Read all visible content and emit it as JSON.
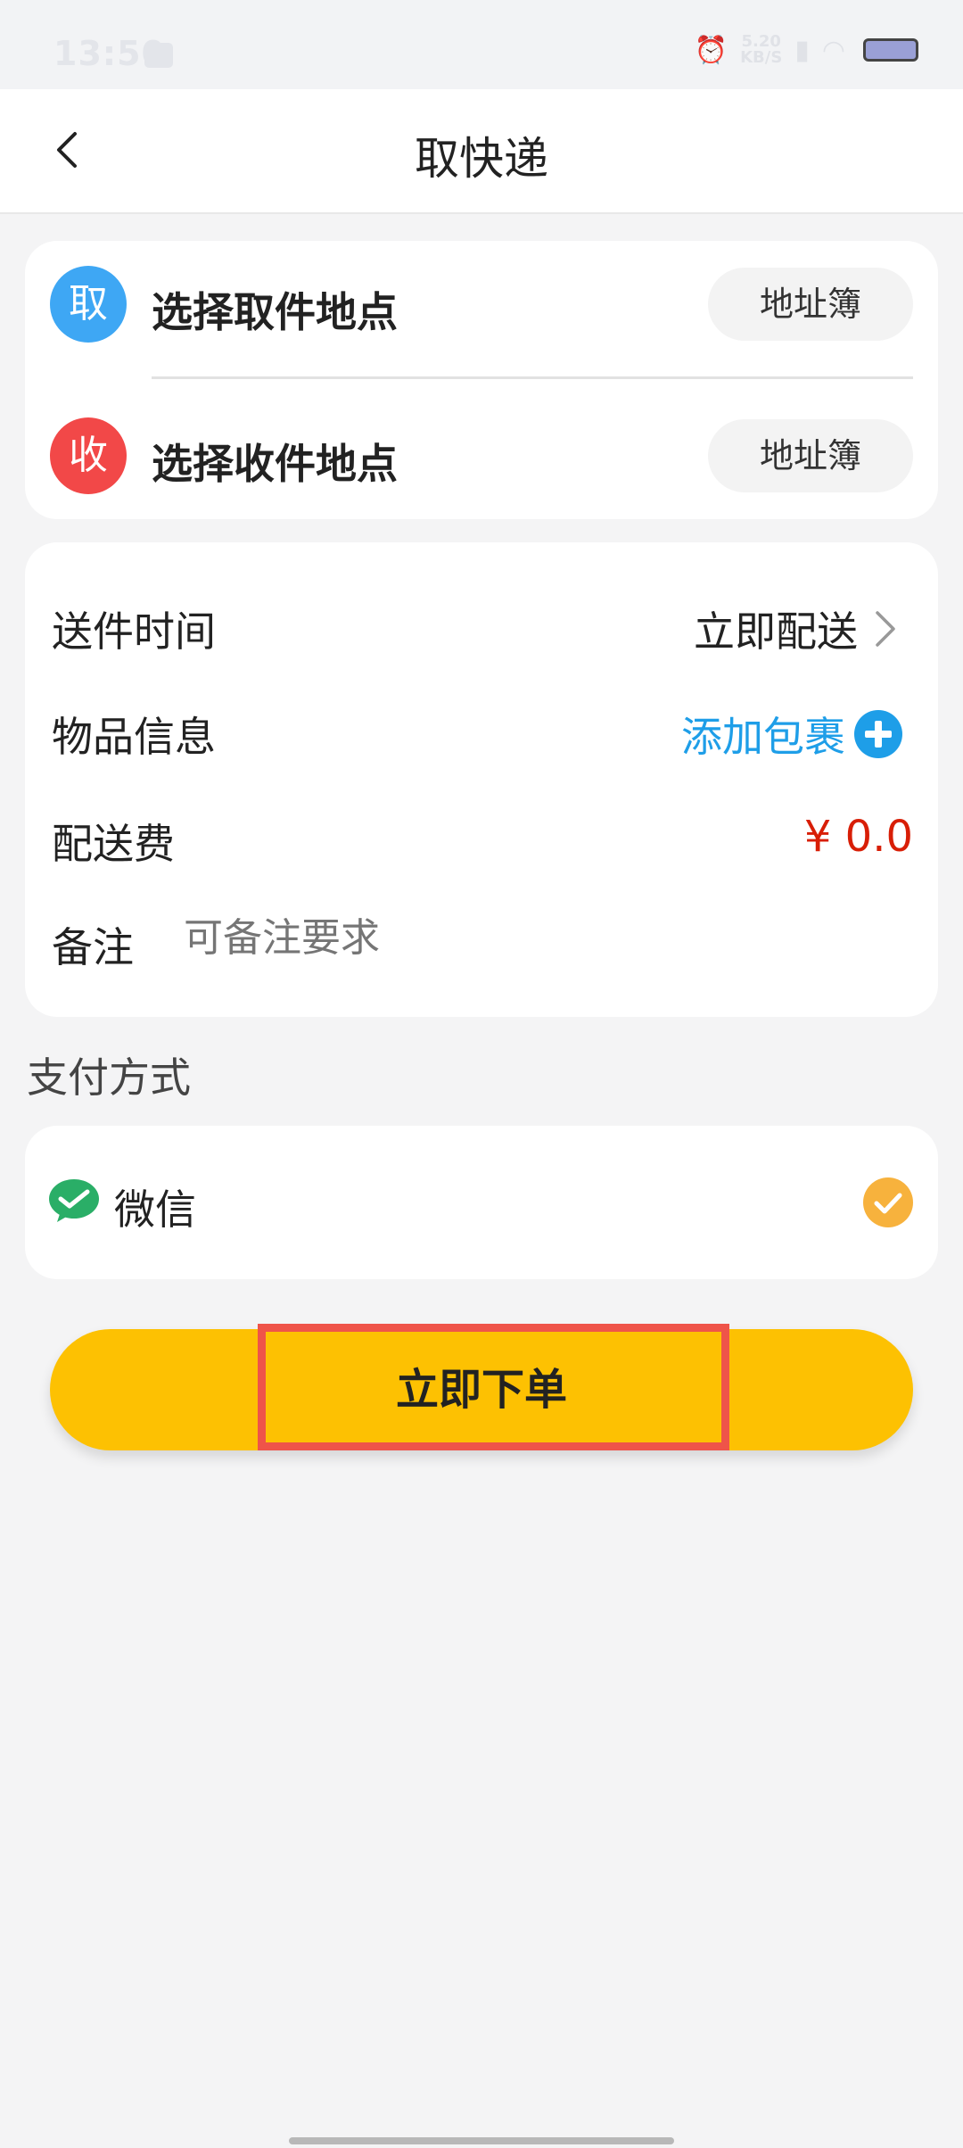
{
  "status_bar": {
    "time": "13:50",
    "speed_value": "5.20",
    "speed_unit": "KB/S"
  },
  "nav": {
    "title": "取快递"
  },
  "address": {
    "pickup": {
      "badge": "取",
      "label": "选择取件地点",
      "book": "地址簿"
    },
    "receive": {
      "badge": "收",
      "label": "选择收件地点",
      "book": "地址簿"
    }
  },
  "info": {
    "time_label": "送件时间",
    "time_value": "立即配送",
    "item_label": "物品信息",
    "item_action": "添加包裹",
    "fee_label": "配送费",
    "fee_value": "¥ 0.0",
    "remark_label": "备注",
    "remark_placeholder": "可备注要求"
  },
  "payment": {
    "section_title": "支付方式",
    "method": "微信",
    "selected": true
  },
  "order_button": "立即下单",
  "colors": {
    "accent": "#fdc102",
    "link": "#1e9ee8",
    "price": "#d81e06",
    "pickup_badge": "#3ea7f4",
    "receive_badge": "#f24848"
  }
}
